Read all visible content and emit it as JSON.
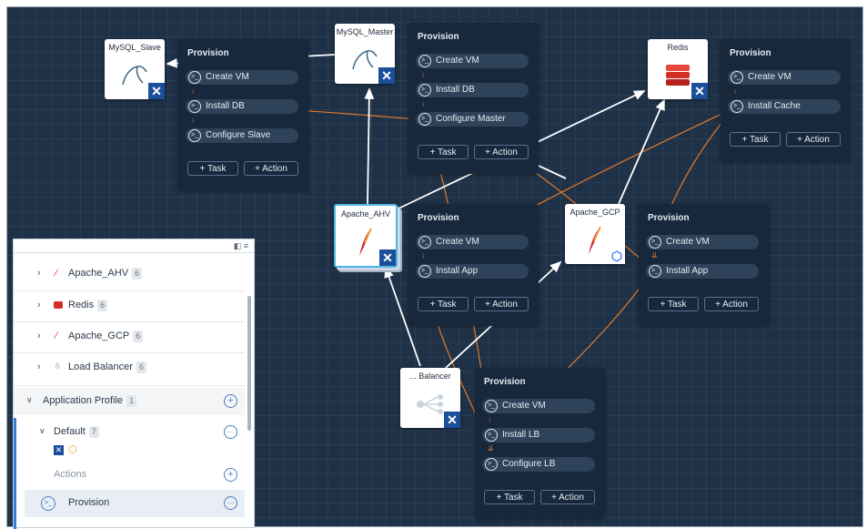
{
  "nodes": {
    "mysql_slave": {
      "title": "MySQL_Slave",
      "icon": "mysql-dolphin-icon"
    },
    "mysql_master": {
      "title": "MySQL_Master",
      "icon": "mysql-dolphin-icon"
    },
    "redis": {
      "title": "Redis",
      "icon": "redis-icon"
    },
    "apache_ahv": {
      "title": "Apache_AHV",
      "icon": "apache-feather-icon"
    },
    "apache_gcp": {
      "title": "Apache_GCP",
      "icon": "apache-feather-icon"
    },
    "load_balancer": {
      "title": "... Balancer",
      "icon": "load-balancer-icon"
    }
  },
  "panels": {
    "slave": {
      "title": "Provision",
      "tasks": [
        "Create VM",
        "Install DB",
        "Configure Slave"
      ]
    },
    "master": {
      "title": "Provision",
      "tasks": [
        "Create VM",
        "Install DB",
        "Configure Master"
      ]
    },
    "redis": {
      "title": "Provision",
      "tasks": [
        "Create VM",
        "Install Cache"
      ]
    },
    "ahv": {
      "title": "Provision",
      "tasks": [
        "Create VM",
        "Install App"
      ]
    },
    "gcp": {
      "title": "Provision",
      "tasks": [
        "Create VM",
        "Install App"
      ]
    },
    "lb": {
      "title": "Provision",
      "tasks": [
        "Create VM",
        "Install LB",
        "Configure LB"
      ]
    }
  },
  "buttons": {
    "task": "Task",
    "action": "Action"
  },
  "sidebar": {
    "services": [
      {
        "label": "Apache_AHV",
        "count": "6"
      },
      {
        "label": "Redis",
        "count": "6"
      },
      {
        "label": "Apache_GCP",
        "count": "6"
      },
      {
        "label": "Load Balancer",
        "count": "6"
      }
    ],
    "profile_label": "Application Profile",
    "profile_count": "1",
    "default_label": "Default",
    "default_count": "7",
    "actions_label": "Actions",
    "provision_label": "Provision"
  },
  "colors": {
    "canvas": "#1f3147",
    "panel": "#17283c",
    "dependency_arrow": "#ffffff",
    "task_link": "#e07a2a",
    "accent": "#4a7fc1"
  }
}
